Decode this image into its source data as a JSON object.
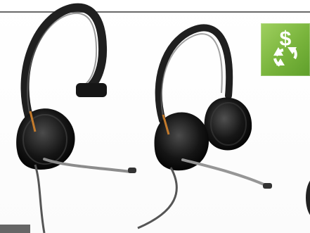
{
  "scene": {
    "background_color": "#ffffff",
    "rule_color": "#6a6a6a",
    "tab_color": "#666666"
  },
  "badge": {
    "icon": "recycle-dollar-icon",
    "color": "#7bb83e"
  },
  "products": [
    {
      "icon": "monaural-headset-icon",
      "color": "#1c1c1c"
    },
    {
      "icon": "binaural-headset-icon",
      "color": "#1c1c1c"
    }
  ]
}
